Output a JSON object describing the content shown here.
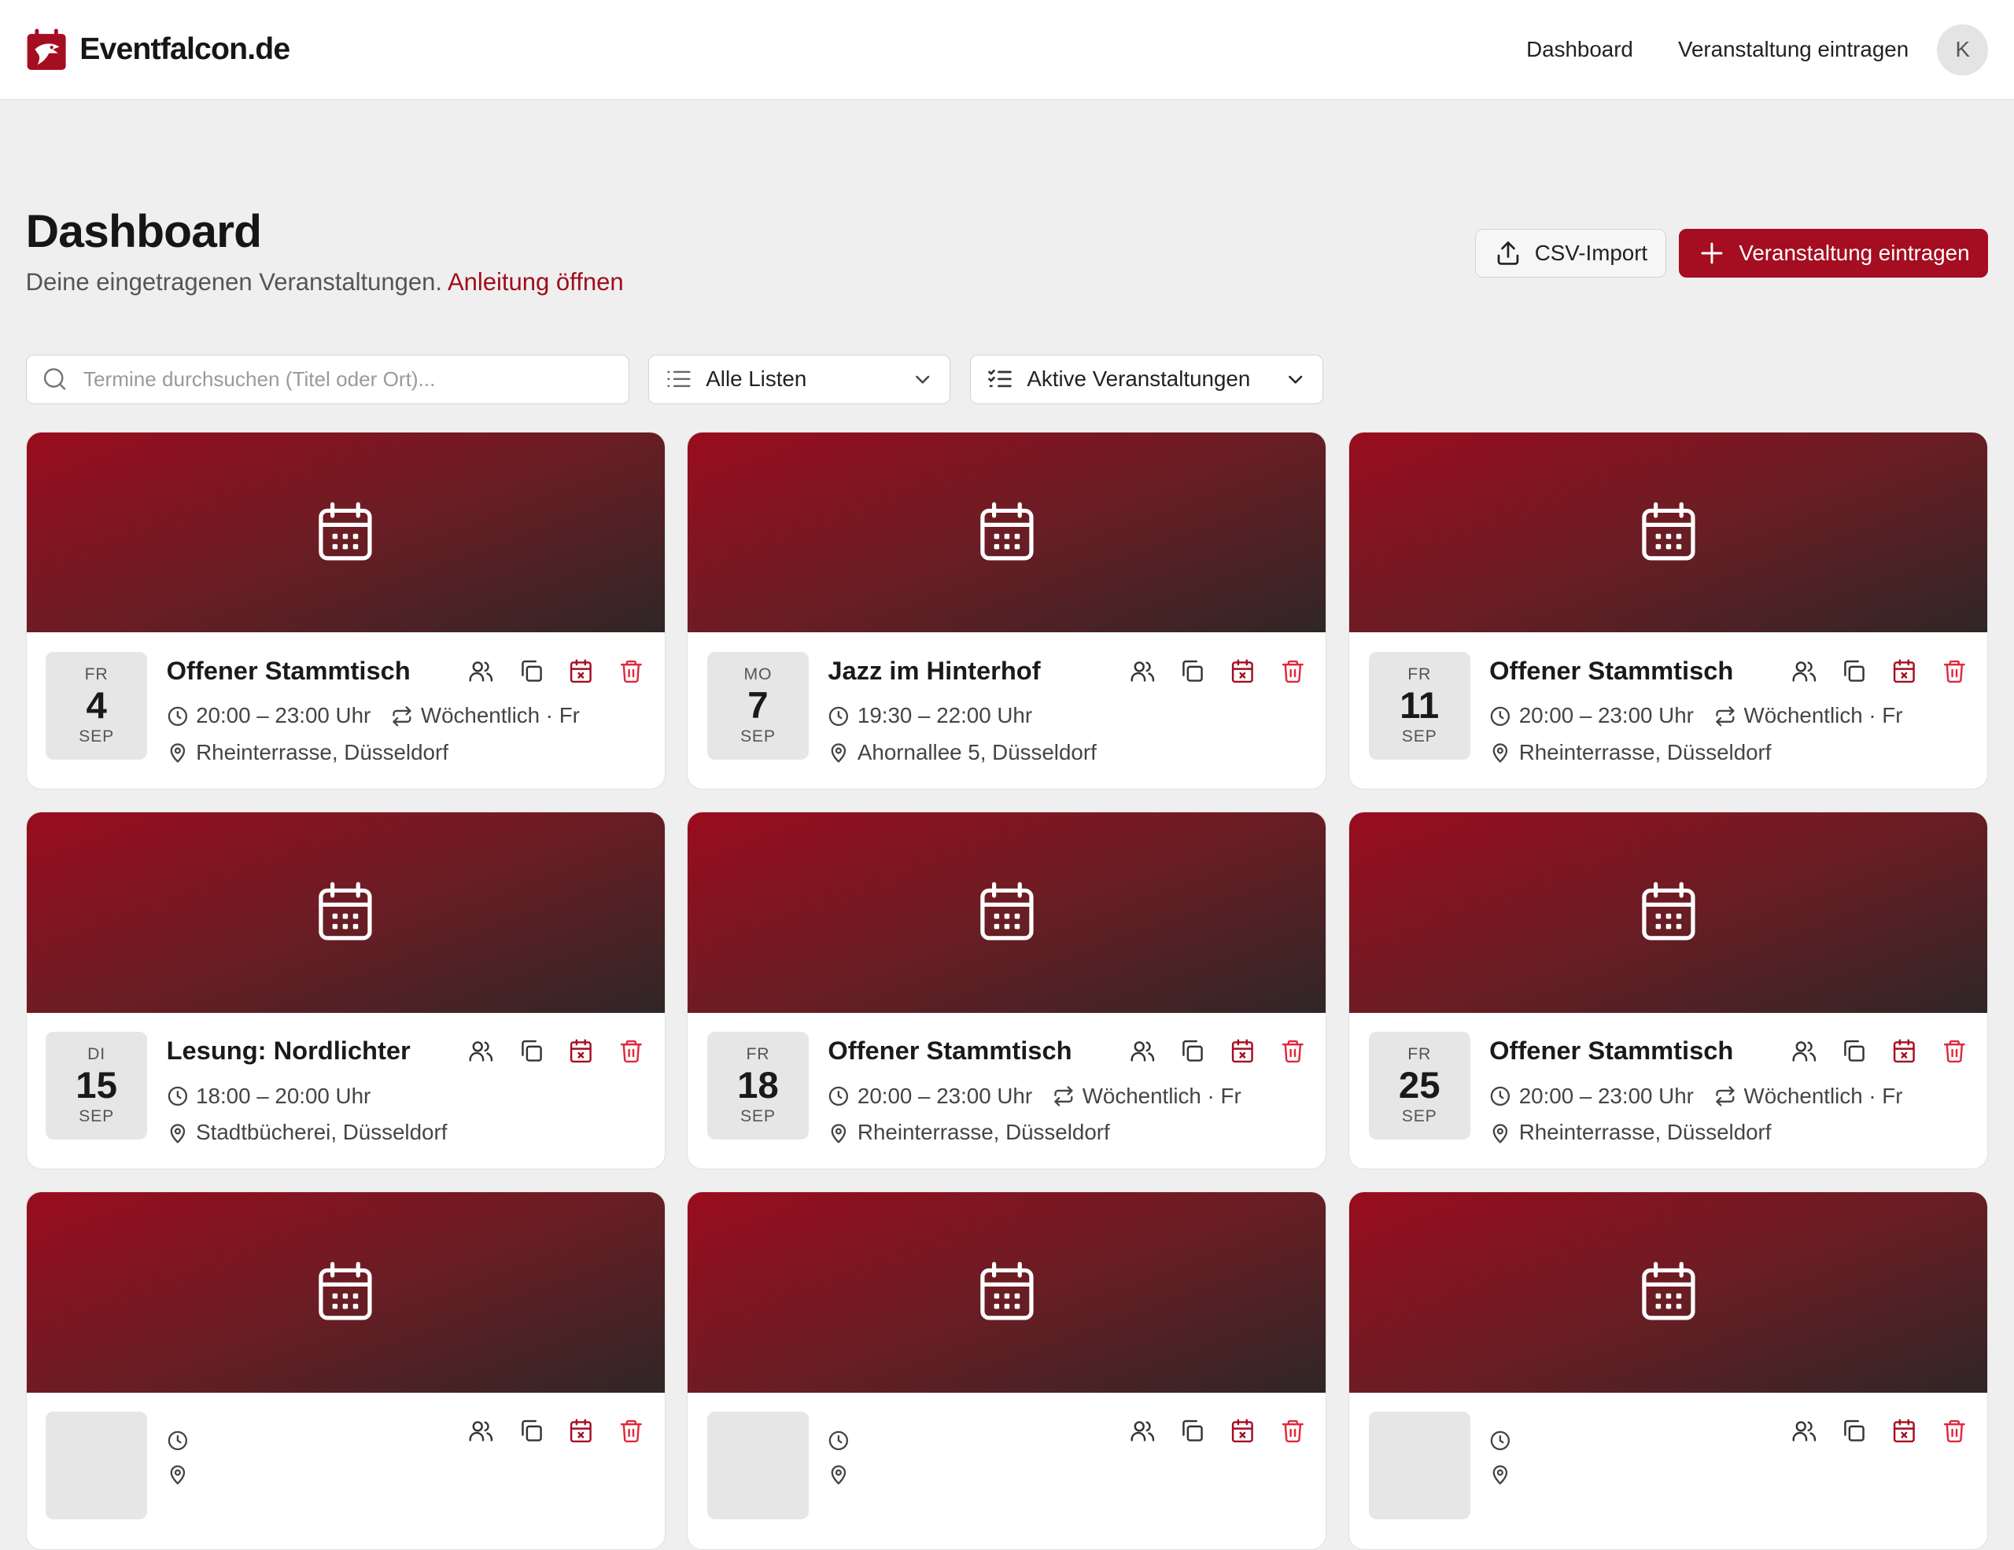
{
  "brand": {
    "name": "Eventfalcon.de",
    "accent": "#a50d20"
  },
  "nav": {
    "dashboard": "Dashboard",
    "add_event": "Veranstaltung eintragen",
    "avatar_initial": "K"
  },
  "header": {
    "title": "Dashboard",
    "subtitle": "Deine eingetragenen Veranstaltungen.",
    "guide_link": "Anleitung öffnen"
  },
  "actions": {
    "csv_import": "CSV-Import",
    "add_event": "Veranstaltung eintragen"
  },
  "filters": {
    "search_placeholder": "Termine durchsuchen (Titel oder Ort)...",
    "lists_value": "Alle Listen",
    "status_value": "Aktive Veranstaltungen"
  },
  "events": [
    {
      "dow": "FR",
      "day": "4",
      "mon": "SEP",
      "title": "Offener Stammtisch",
      "time": "20:00 – 23:00 Uhr",
      "recurrence": "Wöchentlich · Fr",
      "location": "Rheinterrasse, Düsseldorf"
    },
    {
      "dow": "MO",
      "day": "7",
      "mon": "SEP",
      "title": "Jazz im Hinterhof",
      "time": "19:30 – 22:00 Uhr",
      "recurrence": "",
      "location": "Ahornallee 5, Düsseldorf"
    },
    {
      "dow": "FR",
      "day": "11",
      "mon": "SEP",
      "title": "Offener Stammtisch",
      "time": "20:00 – 23:00 Uhr",
      "recurrence": "Wöchentlich · Fr",
      "location": "Rheinterrasse, Düsseldorf"
    },
    {
      "dow": "DI",
      "day": "15",
      "mon": "SEP",
      "title": "Lesung: Nordlichter",
      "time": "18:00 – 20:00 Uhr",
      "recurrence": "",
      "location": "Stadtbücherei, Düsseldorf"
    },
    {
      "dow": "FR",
      "day": "18",
      "mon": "SEP",
      "title": "Offener Stammtisch",
      "time": "20:00 – 23:00 Uhr",
      "recurrence": "Wöchentlich · Fr",
      "location": "Rheinterrasse, Düsseldorf"
    },
    {
      "dow": "FR",
      "day": "25",
      "mon": "SEP",
      "title": "Offener Stammtisch",
      "time": "20:00 – 23:00 Uhr",
      "recurrence": "Wöchentlich · Fr",
      "location": "Rheinterrasse, Düsseldorf"
    },
    {
      "dow": "",
      "day": "",
      "mon": "",
      "title": "",
      "time": "",
      "recurrence": "",
      "location": ""
    },
    {
      "dow": "",
      "day": "",
      "mon": "",
      "title": "",
      "time": "",
      "recurrence": "",
      "location": ""
    },
    {
      "dow": "",
      "day": "",
      "mon": "",
      "title": "",
      "time": "",
      "recurrence": "",
      "location": ""
    }
  ],
  "icons": [
    "calendar-icon",
    "users-icon",
    "copy-icon",
    "calendar-x-icon",
    "trash-icon",
    "clock-icon",
    "repeat-icon",
    "map-pin-icon",
    "search-icon",
    "list-icon",
    "checklist-icon",
    "chevron-down-icon",
    "upload-icon",
    "plus-icon"
  ]
}
